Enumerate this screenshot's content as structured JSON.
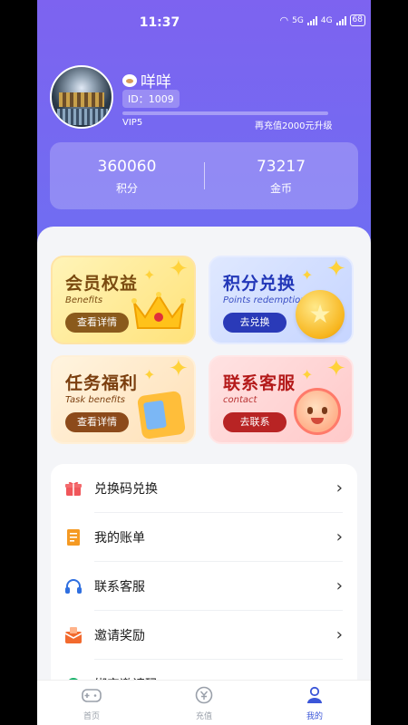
{
  "status": {
    "time": "11:37",
    "network1": "5G",
    "network2": "4G",
    "battery": "68"
  },
  "profile": {
    "username": "咩咩",
    "id_label": "ID：1009",
    "vip_level": "VIP5",
    "upgrade_text": "再充值2000元升级"
  },
  "stats": [
    {
      "value": "360060",
      "label": "积分"
    },
    {
      "value": "73217",
      "label": "金币"
    }
  ],
  "cards": [
    {
      "title": "会员权益",
      "subtitle": "Benefits",
      "button": "查看详情"
    },
    {
      "title": "积分兑换",
      "subtitle": "Points redemption",
      "button": "去兑换"
    },
    {
      "title": "任务福利",
      "subtitle": "Task benefits",
      "button": "查看详情"
    },
    {
      "title": "联系客服",
      "subtitle": "contact",
      "button": "去联系"
    }
  ],
  "menu": [
    {
      "label": "兑换码兑换",
      "icon": "gift-icon"
    },
    {
      "label": "我的账单",
      "icon": "bill-icon"
    },
    {
      "label": "联系客服",
      "icon": "headset-icon"
    },
    {
      "label": "邀请奖励",
      "icon": "invite-icon"
    },
    {
      "label": "绑定邀请码",
      "icon": "bind-icon"
    }
  ],
  "tabs": [
    {
      "label": "首页",
      "icon": "gamepad-icon"
    },
    {
      "label": "充值",
      "icon": "recharge-icon"
    },
    {
      "label": "我的",
      "icon": "user-icon",
      "active": true
    }
  ],
  "colors": {
    "accent": "#3b56d8",
    "header_start": "#7d63f0",
    "header_end": "#5b7cf4"
  }
}
